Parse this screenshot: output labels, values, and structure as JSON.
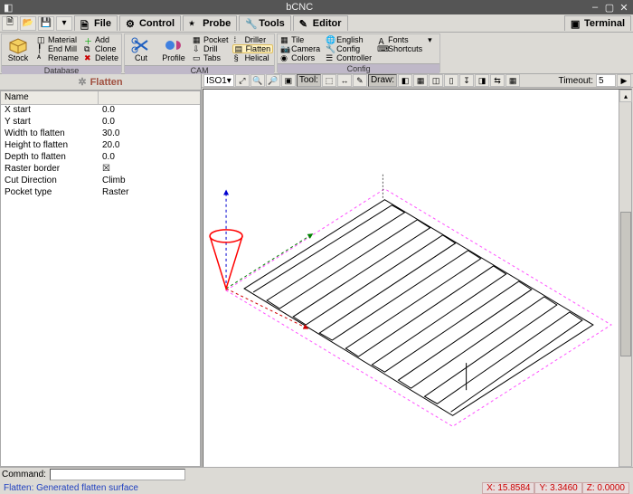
{
  "title": "bCNC",
  "maintabs": [
    "File",
    "Control",
    "Probe",
    "Tools",
    "Editor"
  ],
  "terminal_label": "Terminal",
  "ribbon": {
    "groups": [
      {
        "label": "Database",
        "big": {
          "label": "Stock"
        },
        "rows": [
          [
            "Material",
            "Add"
          ],
          [
            "End Mill",
            "Clone"
          ],
          [
            "Rename",
            "Delete"
          ]
        ]
      },
      {
        "label": "CAM",
        "big1": {
          "label": "Cut"
        },
        "big2": {
          "label": "Profile"
        },
        "rows": [
          [
            "Pocket",
            "Driller"
          ],
          [
            "Drill",
            "Flatten"
          ],
          [
            "Tabs",
            "Helical"
          ]
        ]
      },
      {
        "label": "Config",
        "rows": [
          [
            "Tile",
            "English"
          ],
          [
            "Camera",
            "Config",
            "Fonts"
          ],
          [
            "Colors",
            "Controller",
            "Shortcuts"
          ]
        ]
      }
    ]
  },
  "panel_title": "Flatten",
  "props_header": "Name",
  "props": [
    {
      "name": "X start",
      "value": "0.0"
    },
    {
      "name": "Y start",
      "value": "0.0"
    },
    {
      "name": "Width to flatten",
      "value": "30.0"
    },
    {
      "name": "Height to flatten",
      "value": "20.0"
    },
    {
      "name": "Depth to flatten",
      "value": "0.0"
    },
    {
      "name": "Raster border",
      "value": "☒"
    },
    {
      "name": "Cut Direction",
      "value": "Climb"
    },
    {
      "name": "Pocket type",
      "value": "Raster"
    }
  ],
  "view_toolbar": {
    "iso": "ISO1",
    "tool": "Tool:",
    "draw": "Draw:",
    "timeout_label": "Timeout:",
    "timeout_value": "5"
  },
  "command_label": "Command:",
  "status_msg": "Flatten: Generated flatten surface",
  "coords": {
    "x": "X: 15.8584",
    "y": "Y: 3.3460",
    "z": "Z: 0.0000"
  }
}
